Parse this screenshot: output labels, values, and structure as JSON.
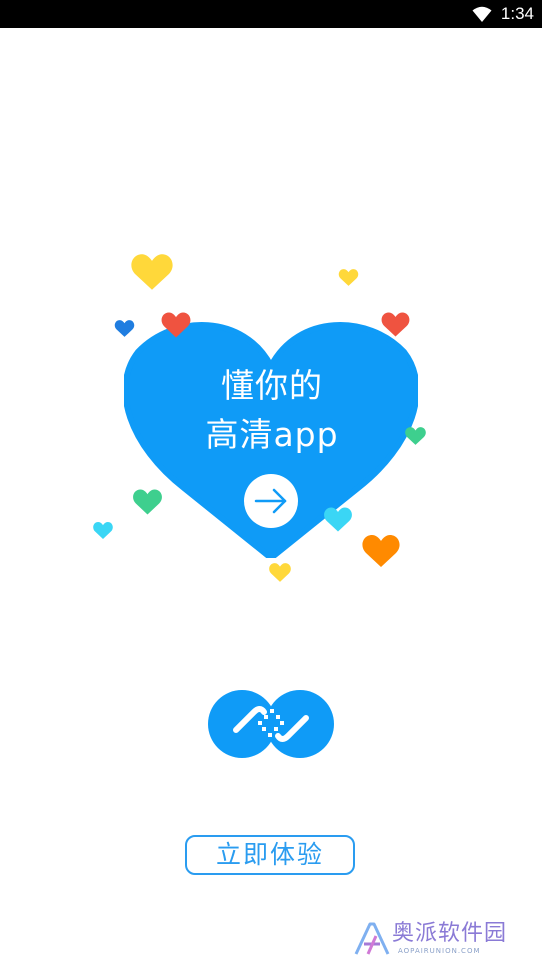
{
  "status_bar": {
    "time": "1:34",
    "wifi_icon": "wifi-icon"
  },
  "hero": {
    "line1": "懂你的",
    "line2": "高清app",
    "arrow_icon": "arrow-right-icon",
    "heart_color": "#0f9bf7"
  },
  "logo": {
    "icon": "infinity-film-logo",
    "color": "#0f9bf7"
  },
  "cta": {
    "label": "立即体验"
  },
  "watermark": {
    "brand": "奥派软件园",
    "sub": "AOPAIRUNION.COM"
  },
  "colors": {
    "accent": "#0f9bf7",
    "yellow": "#ffd83a",
    "red": "#ef5340",
    "green": "#3ecf8e",
    "cyan": "#3ad6f5",
    "orange": "#ff8a00",
    "deep_blue": "#1f7de0"
  }
}
